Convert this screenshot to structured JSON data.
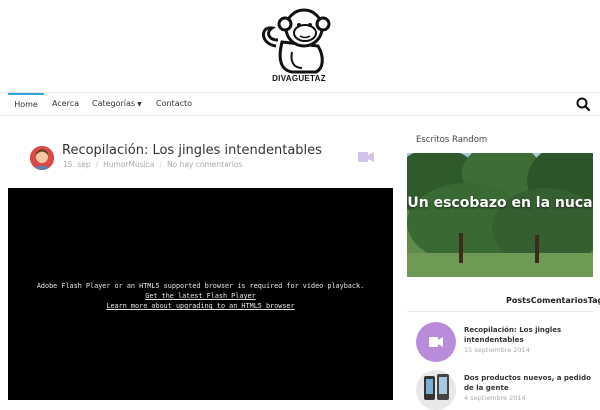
{
  "site": {
    "logo_text": "DIVAGUETAZ"
  },
  "nav": {
    "items": [
      "Home",
      "Acerca",
      "Categorías",
      "Contacto"
    ],
    "active": "Home",
    "accent": "#34a3dc"
  },
  "post": {
    "title": "Recopilación: Los jingles intendentables",
    "date": "15. sep",
    "category": "HumorMusica",
    "comments": "No hay comentarios"
  },
  "player": {
    "message": "Adobe Flash Player or an HTML5 supported browser is required for video playback.",
    "link1": "Get the latest Flash Player",
    "link2": "Learn more about upgrading to an HTML5 browser"
  },
  "sidebar": {
    "random_title": "Escritos Random",
    "random_caption": "Un escobazo en la nuca",
    "tabs": [
      "Posts",
      "Comentarios",
      "Tags"
    ],
    "items": [
      {
        "title": "Recopilación: Los jingles intendentables",
        "date": "15 septiembre 2014",
        "icon": "video-icon",
        "color": "#b98cdb"
      },
      {
        "title": "Dos productos nuevos, a pedido de la gente",
        "date": "4 septiembre 2014",
        "icon": "phones-image",
        "color": "#555555"
      }
    ]
  }
}
